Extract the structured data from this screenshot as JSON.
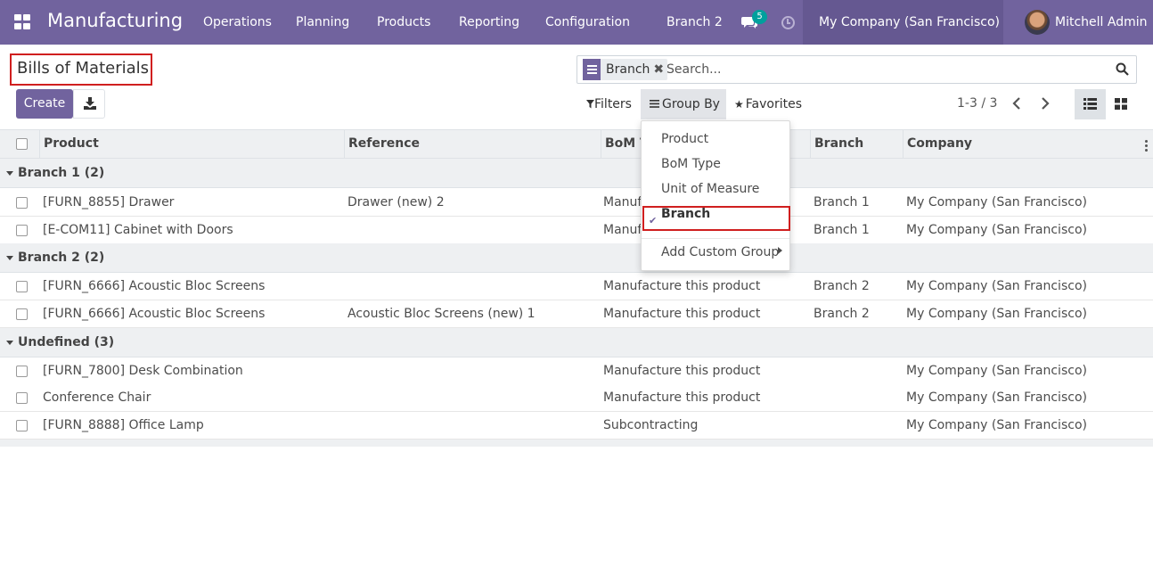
{
  "navbar": {
    "app_title": "Manufacturing",
    "menus": [
      "Operations",
      "Planning",
      "Products",
      "Reporting",
      "Configuration"
    ],
    "branch": "Branch 2",
    "chat_count": "5",
    "company": "My Company (San Francisco)",
    "user": "Mitchell Admin",
    "color": "#71639e"
  },
  "page": {
    "title": "Bills of Materials",
    "create_label": "Create"
  },
  "search": {
    "facet_label": "Branch",
    "facet_remove": "✖",
    "placeholder": "Search..."
  },
  "filters": {
    "filters_label": "Filters",
    "groupby_label": "Group By",
    "favorites_label": "Favorites"
  },
  "pager": {
    "text": "1-3 / 3"
  },
  "table": {
    "columns": [
      "Product",
      "Reference",
      "BoM T",
      "Branch",
      "Company"
    ],
    "groups": [
      {
        "label": "Branch 1 (2)",
        "rows": [
          {
            "product": "[FURN_8855] Drawer",
            "reference": "Drawer (new) 2",
            "bom_type": "Manufa",
            "branch": "Branch 1",
            "company": "My Company (San Francisco)"
          },
          {
            "product": "[E-COM11] Cabinet with Doors",
            "reference": "",
            "bom_type": "Manufa",
            "branch": "Branch 1",
            "company": "My Company (San Francisco)"
          }
        ]
      },
      {
        "label": "Branch 2 (2)",
        "rows": [
          {
            "product": "[FURN_6666] Acoustic Bloc Screens",
            "reference": "",
            "bom_type": "Manufacture this product",
            "branch": "Branch 2",
            "company": "My Company (San Francisco)"
          },
          {
            "product": "[FURN_6666] Acoustic Bloc Screens",
            "reference": "Acoustic Bloc Screens (new) 1",
            "bom_type": "Manufacture this product",
            "branch": "Branch 2",
            "company": "My Company (San Francisco)"
          }
        ]
      },
      {
        "label": "Undefined (3)",
        "rows": [
          {
            "product": "[FURN_7800] Desk Combination",
            "reference": "",
            "bom_type": "Manufacture this product",
            "branch": "",
            "company": "My Company (San Francisco)"
          },
          {
            "product": "Conference Chair",
            "reference": "",
            "bom_type": "Manufacture this product",
            "branch": "",
            "company": "My Company (San Francisco)"
          },
          {
            "product": "[FURN_8888] Office Lamp",
            "reference": "",
            "bom_type": "Subcontracting",
            "branch": "",
            "company": "My Company (San Francisco)"
          }
        ]
      }
    ]
  },
  "groupby_dropdown": {
    "items": [
      "Product",
      "BoM Type",
      "Unit of Measure",
      "Branch"
    ],
    "selected": "Branch",
    "check": "✔",
    "custom_group": "Add Custom Group"
  }
}
